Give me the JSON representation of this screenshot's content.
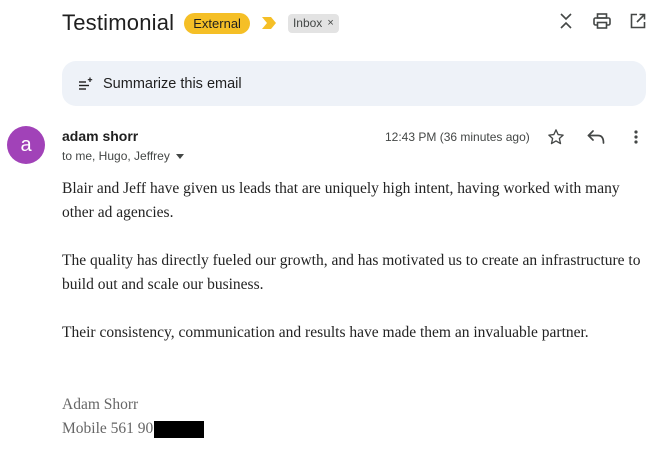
{
  "header": {
    "subject": "Testimonial",
    "external_label": "External",
    "label_chip": "Inbox",
    "label_chip_close": "×",
    "icons": [
      "expand-collapse-icon",
      "print-icon",
      "open-in-new-window-icon"
    ]
  },
  "summarize": {
    "label": "Summarize this email",
    "icon": "sparkle-list-icon"
  },
  "message": {
    "avatar_letter": "a",
    "avatar_color": "#a142b8",
    "sender": "adam shorr",
    "recipients": "to me, Hugo, Jeffrey",
    "timestamp": "12:43 PM (36 minutes ago)",
    "actions": [
      "star-icon",
      "reply-icon",
      "more-options-icon"
    ],
    "body": [
      "Blair and Jeff have given us leads that are uniquely high intent, having worked with many other ad agencies.",
      "The quality has directly fueled our growth, and has motivated us to create an infrastructure to build out and scale our business.",
      "Their consistency, communication and results have made them an invaluable partner."
    ],
    "signature": {
      "name": "Adam Shorr",
      "phone_prefix": "Mobile 561 90"
    }
  },
  "colors": {
    "external_badge": "#f5bf26",
    "summarize_bg": "#eef2f8",
    "importance_marker": "#f5bf26"
  }
}
